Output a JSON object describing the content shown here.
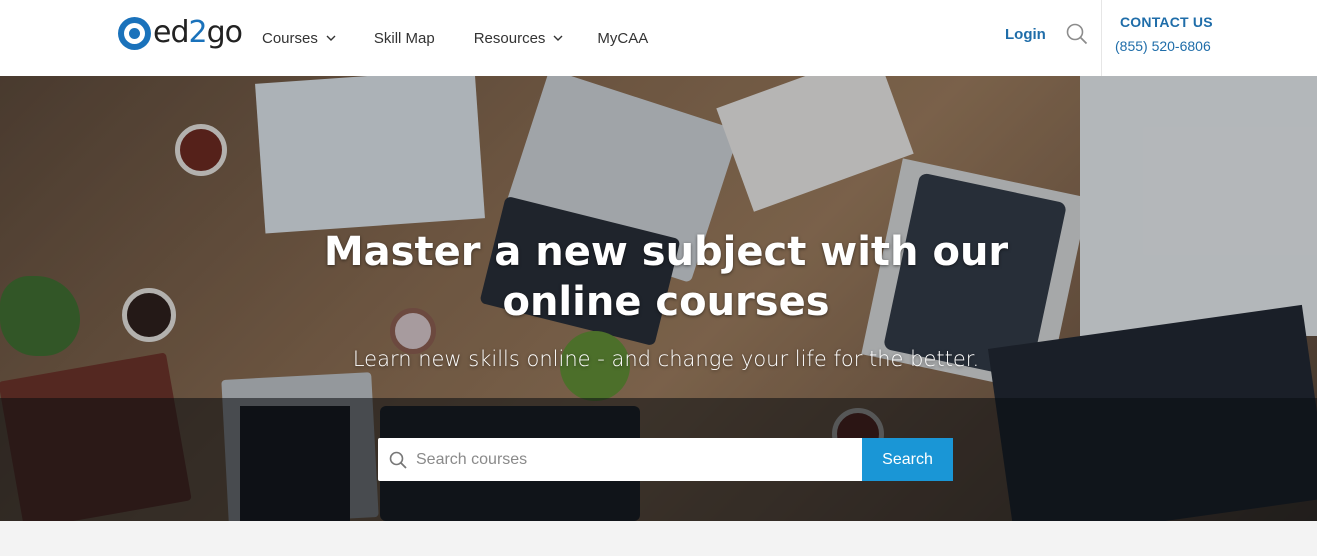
{
  "brand": {
    "name_part1": "ed",
    "name_part2": "2",
    "name_part3": "go",
    "colors": {
      "primary": "#1a72bb",
      "link": "#1f6da9",
      "button": "#1a96d6"
    }
  },
  "nav": {
    "items": [
      {
        "label": "Courses",
        "has_dropdown": true
      },
      {
        "label": "Skill Map",
        "has_dropdown": false
      },
      {
        "label": "Resources",
        "has_dropdown": true
      },
      {
        "label": "MyCAA",
        "has_dropdown": false
      }
    ]
  },
  "header": {
    "login_label": "Login",
    "search_icon": "search-icon",
    "contact_label": "CONTACT US",
    "phone": "(855) 520-6806"
  },
  "hero": {
    "title": "Master a new subject with our online courses",
    "subtitle": "Learn new skills online - and change your life for the better.",
    "search": {
      "placeholder": "Search courses",
      "value": "",
      "button_label": "Search"
    }
  }
}
